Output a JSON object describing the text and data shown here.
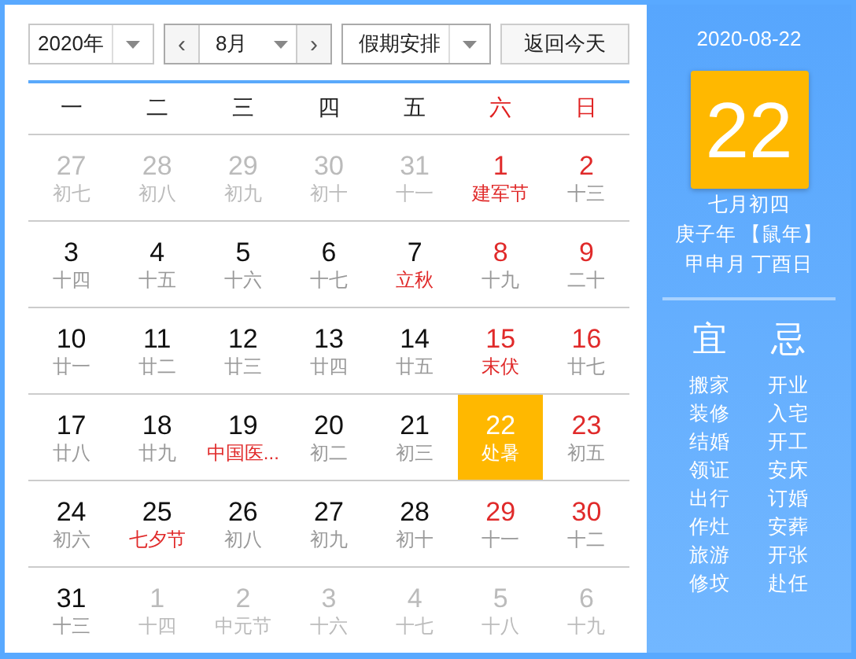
{
  "toolbar": {
    "year": "2020年",
    "prev": "‹",
    "month": "8月",
    "next": "›",
    "holiday": "假期安排",
    "today_button": "返回今天"
  },
  "weekdays": [
    {
      "label": "一",
      "weekend": false
    },
    {
      "label": "二",
      "weekend": false
    },
    {
      "label": "三",
      "weekend": false
    },
    {
      "label": "四",
      "weekend": false
    },
    {
      "label": "五",
      "weekend": false
    },
    {
      "label": "六",
      "weekend": true
    },
    {
      "label": "日",
      "weekend": true
    }
  ],
  "days": [
    {
      "day": "27",
      "lunar": "初七",
      "other_month": true,
      "weekend": false,
      "festival": false,
      "selected": false
    },
    {
      "day": "28",
      "lunar": "初八",
      "other_month": true,
      "weekend": false,
      "festival": false,
      "selected": false
    },
    {
      "day": "29",
      "lunar": "初九",
      "other_month": true,
      "weekend": false,
      "festival": false,
      "selected": false
    },
    {
      "day": "30",
      "lunar": "初十",
      "other_month": true,
      "weekend": false,
      "festival": false,
      "selected": false
    },
    {
      "day": "31",
      "lunar": "十一",
      "other_month": true,
      "weekend": false,
      "festival": false,
      "selected": false
    },
    {
      "day": "1",
      "lunar": "建军节",
      "other_month": false,
      "weekend": true,
      "festival": true,
      "selected": false
    },
    {
      "day": "2",
      "lunar": "十三",
      "other_month": false,
      "weekend": true,
      "festival": false,
      "selected": false
    },
    {
      "day": "3",
      "lunar": "十四",
      "other_month": false,
      "weekend": false,
      "festival": false,
      "selected": false
    },
    {
      "day": "4",
      "lunar": "十五",
      "other_month": false,
      "weekend": false,
      "festival": false,
      "selected": false
    },
    {
      "day": "5",
      "lunar": "十六",
      "other_month": false,
      "weekend": false,
      "festival": false,
      "selected": false
    },
    {
      "day": "6",
      "lunar": "十七",
      "other_month": false,
      "weekend": false,
      "festival": false,
      "selected": false
    },
    {
      "day": "7",
      "lunar": "立秋",
      "other_month": false,
      "weekend": false,
      "festival": true,
      "selected": false
    },
    {
      "day": "8",
      "lunar": "十九",
      "other_month": false,
      "weekend": true,
      "festival": false,
      "selected": false
    },
    {
      "day": "9",
      "lunar": "二十",
      "other_month": false,
      "weekend": true,
      "festival": false,
      "selected": false
    },
    {
      "day": "10",
      "lunar": "廿一",
      "other_month": false,
      "weekend": false,
      "festival": false,
      "selected": false
    },
    {
      "day": "11",
      "lunar": "廿二",
      "other_month": false,
      "weekend": false,
      "festival": false,
      "selected": false
    },
    {
      "day": "12",
      "lunar": "廿三",
      "other_month": false,
      "weekend": false,
      "festival": false,
      "selected": false
    },
    {
      "day": "13",
      "lunar": "廿四",
      "other_month": false,
      "weekend": false,
      "festival": false,
      "selected": false
    },
    {
      "day": "14",
      "lunar": "廿五",
      "other_month": false,
      "weekend": false,
      "festival": false,
      "selected": false
    },
    {
      "day": "15",
      "lunar": "末伏",
      "other_month": false,
      "weekend": true,
      "festival": true,
      "selected": false
    },
    {
      "day": "16",
      "lunar": "廿七",
      "other_month": false,
      "weekend": true,
      "festival": false,
      "selected": false
    },
    {
      "day": "17",
      "lunar": "廿八",
      "other_month": false,
      "weekend": false,
      "festival": false,
      "selected": false
    },
    {
      "day": "18",
      "lunar": "廿九",
      "other_month": false,
      "weekend": false,
      "festival": false,
      "selected": false
    },
    {
      "day": "19",
      "lunar": "中国医...",
      "other_month": false,
      "weekend": false,
      "festival": true,
      "selected": false
    },
    {
      "day": "20",
      "lunar": "初二",
      "other_month": false,
      "weekend": false,
      "festival": false,
      "selected": false
    },
    {
      "day": "21",
      "lunar": "初三",
      "other_month": false,
      "weekend": false,
      "festival": false,
      "selected": false
    },
    {
      "day": "22",
      "lunar": "处暑",
      "other_month": false,
      "weekend": true,
      "festival": true,
      "selected": true
    },
    {
      "day": "23",
      "lunar": "初五",
      "other_month": false,
      "weekend": true,
      "festival": false,
      "selected": false
    },
    {
      "day": "24",
      "lunar": "初六",
      "other_month": false,
      "weekend": false,
      "festival": false,
      "selected": false
    },
    {
      "day": "25",
      "lunar": "七夕节",
      "other_month": false,
      "weekend": false,
      "festival": true,
      "selected": false
    },
    {
      "day": "26",
      "lunar": "初八",
      "other_month": false,
      "weekend": false,
      "festival": false,
      "selected": false
    },
    {
      "day": "27",
      "lunar": "初九",
      "other_month": false,
      "weekend": false,
      "festival": false,
      "selected": false
    },
    {
      "day": "28",
      "lunar": "初十",
      "other_month": false,
      "weekend": false,
      "festival": false,
      "selected": false
    },
    {
      "day": "29",
      "lunar": "十一",
      "other_month": false,
      "weekend": true,
      "festival": false,
      "selected": false
    },
    {
      "day": "30",
      "lunar": "十二",
      "other_month": false,
      "weekend": true,
      "festival": false,
      "selected": false
    },
    {
      "day": "31",
      "lunar": "十三",
      "other_month": false,
      "weekend": false,
      "festival": false,
      "selected": false
    },
    {
      "day": "1",
      "lunar": "十四",
      "other_month": true,
      "weekend": false,
      "festival": false,
      "selected": false
    },
    {
      "day": "2",
      "lunar": "中元节",
      "other_month": true,
      "weekend": false,
      "festival": false,
      "selected": false
    },
    {
      "day": "3",
      "lunar": "十六",
      "other_month": true,
      "weekend": false,
      "festival": false,
      "selected": false
    },
    {
      "day": "4",
      "lunar": "十七",
      "other_month": true,
      "weekend": false,
      "festival": false,
      "selected": false
    },
    {
      "day": "5",
      "lunar": "十八",
      "other_month": true,
      "weekend": false,
      "festival": false,
      "selected": false
    },
    {
      "day": "6",
      "lunar": "十九",
      "other_month": true,
      "weekend": false,
      "festival": false,
      "selected": false
    }
  ],
  "detail": {
    "date": "2020-08-22",
    "big_day": "22",
    "lunar_date": "七月初四",
    "year_line": "庚子年 【鼠年】",
    "month_day_line": "甲申月 丁酉日",
    "yi": {
      "title": "宜",
      "items": [
        "搬家",
        "装修",
        "结婚",
        "领证",
        "出行",
        "作灶",
        "旅游",
        "修坟"
      ]
    },
    "ji": {
      "title": "忌",
      "items": [
        "开业",
        "入宅",
        "开工",
        "安床",
        "订婚",
        "安葬",
        "开张",
        "赴任"
      ]
    }
  }
}
